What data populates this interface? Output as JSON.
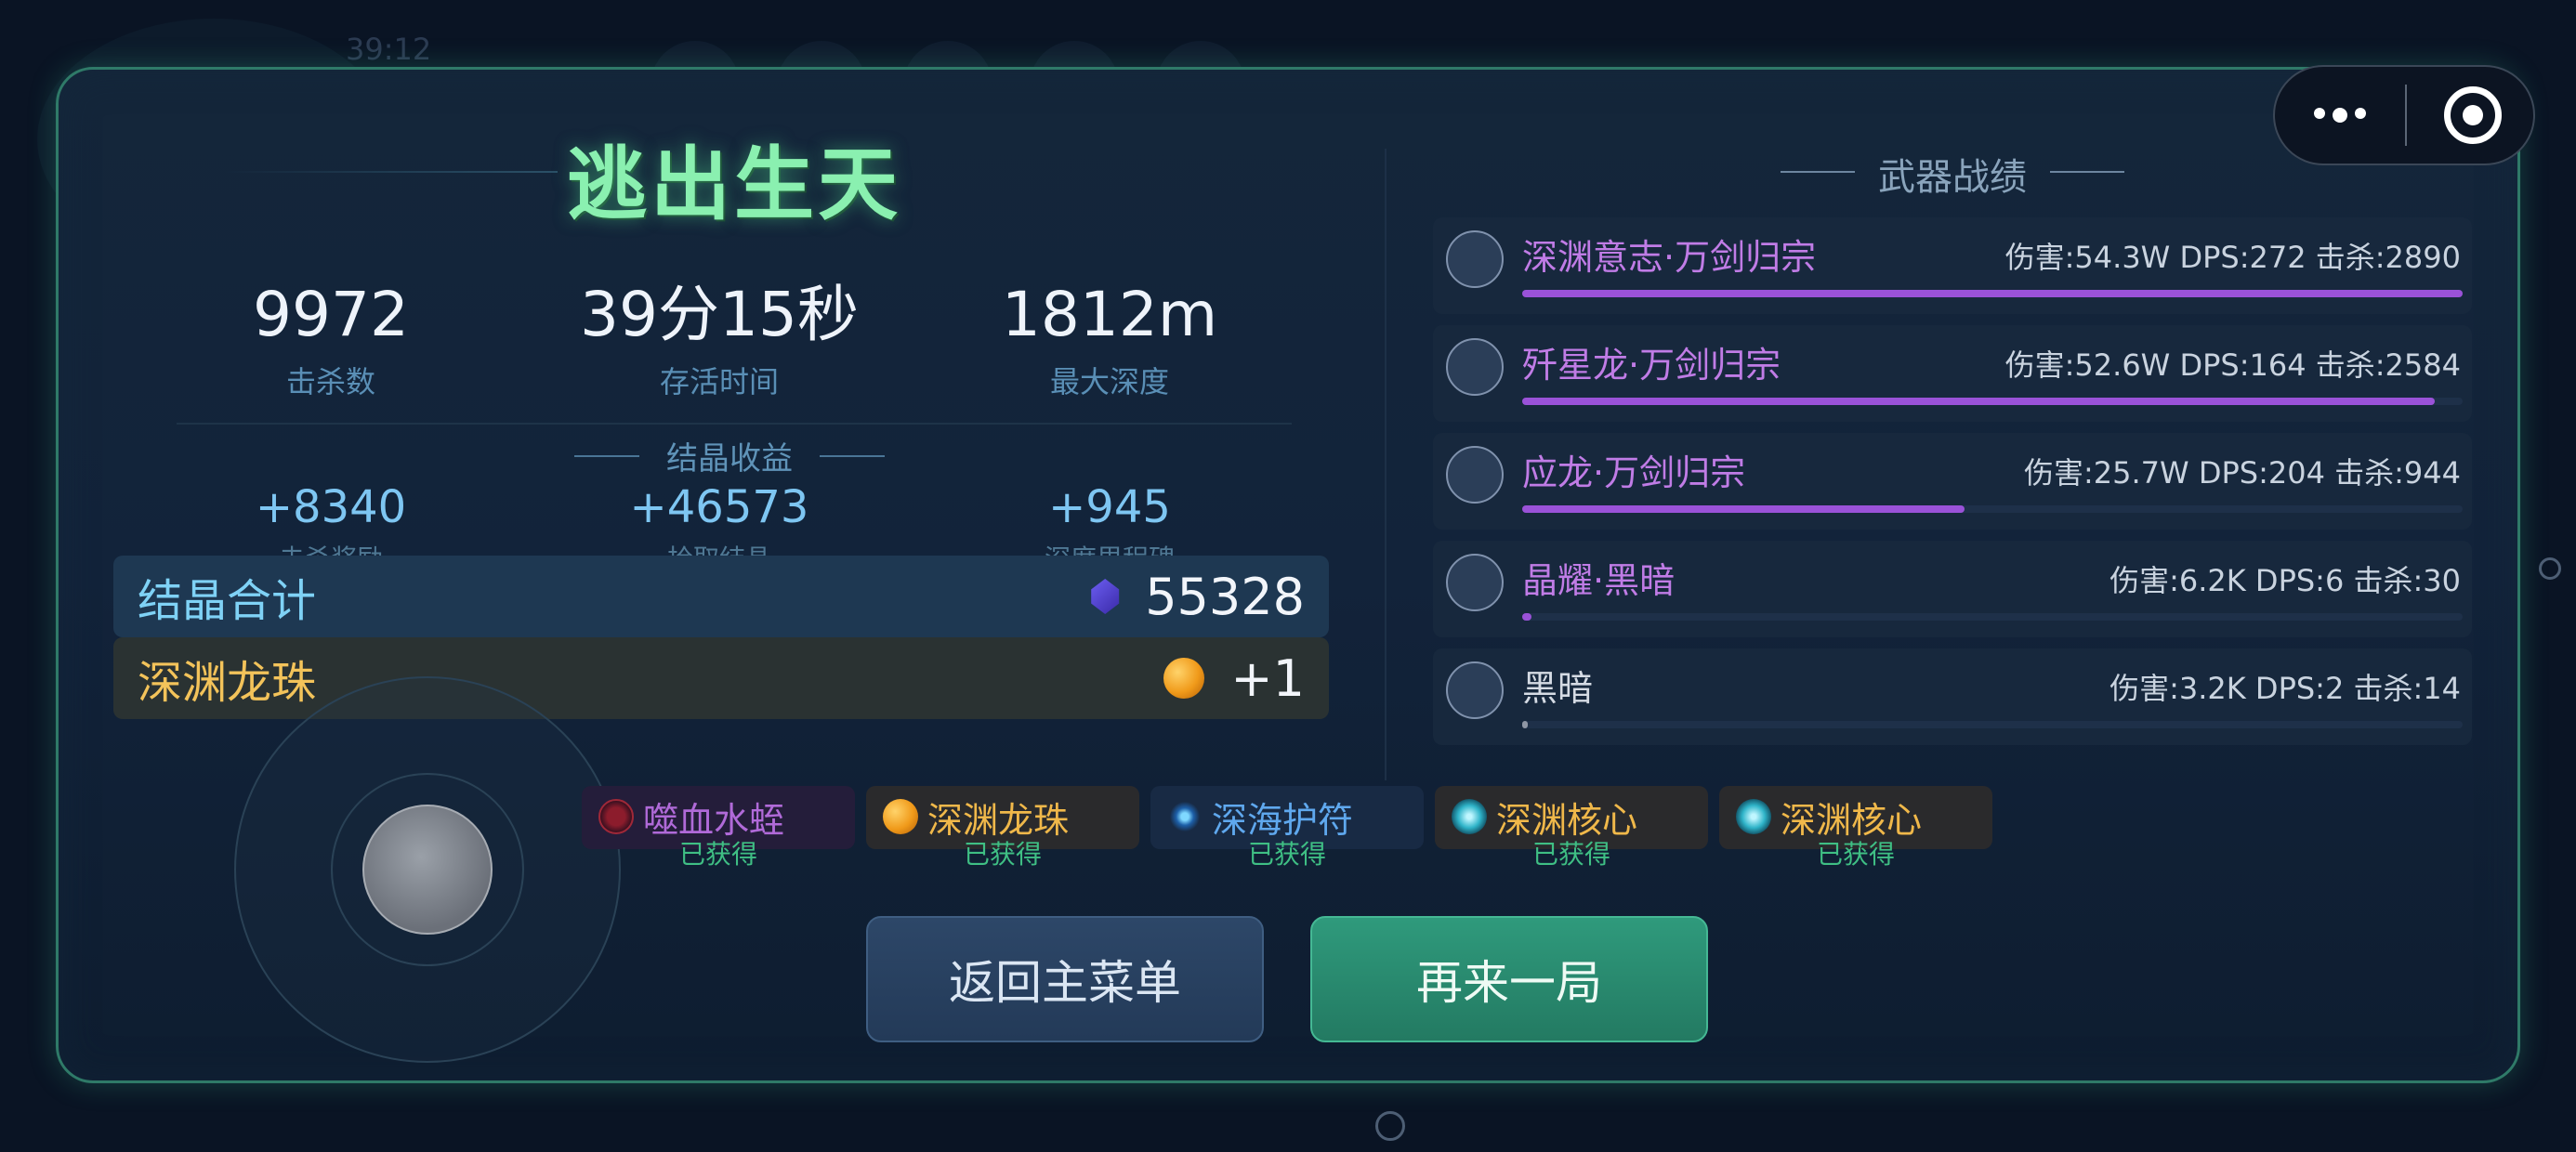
{
  "background": {
    "timer": "39:12"
  },
  "title": "逃出生天",
  "stats": [
    {
      "value": "9972",
      "label": "击杀数"
    },
    {
      "value": "39分15秒",
      "label": "存活时间"
    },
    {
      "value": "1812m",
      "label": "最大深度"
    }
  ],
  "crystal_income": {
    "title": "结晶收益",
    "items": [
      {
        "value": "+8340",
        "label": "击杀奖励"
      },
      {
        "value": "+46573",
        "label": "拾取结晶"
      },
      {
        "value": "+945",
        "label": "深度里程碑"
      }
    ]
  },
  "crystal_total": {
    "label": "结晶合计",
    "icon": "crystal-gem-icon",
    "value": "55328"
  },
  "dragon_pearl": {
    "label": "深渊龙珠",
    "icon": "dragon-pearl-icon",
    "value": "+1"
  },
  "items_obtained": [
    {
      "name": "噬血水蛭",
      "status": "已获得",
      "name_color": "#b06ad8",
      "bg": "#241d3a",
      "icon": "leech-icon"
    },
    {
      "name": "深渊龙珠",
      "status": "已获得",
      "name_color": "#f0b84a",
      "bg": "#2a2a2c",
      "icon": "dragon-pearl-icon"
    },
    {
      "name": "深海护符",
      "status": "已获得",
      "name_color": "#5fa8ee",
      "bg": "#182a44",
      "icon": "amulet-icon"
    },
    {
      "name": "深渊核心",
      "status": "已获得",
      "name_color": "#f0b84a",
      "bg": "#2a2a2c",
      "icon": "abyss-core-icon"
    },
    {
      "name": "深渊核心",
      "status": "已获得",
      "name_color": "#f0b84a",
      "bg": "#2a2a2c",
      "icon": "abyss-core-icon"
    }
  ],
  "buttons": {
    "menu": "返回主菜单",
    "again": "再来一局"
  },
  "weapons": {
    "title": "武器战绩",
    "list": [
      {
        "name": "深渊意志·万剑归宗",
        "stats": "伤害:54.3W DPS:272 击杀:2890",
        "progress": 1.0,
        "name_color": "#c07ce6"
      },
      {
        "name": "歼星龙·万剑归宗",
        "stats": "伤害:52.6W DPS:164 击杀:2584",
        "progress": 0.97,
        "name_color": "#c07ce6"
      },
      {
        "name": "应龙·万剑归宗",
        "stats": "伤害:25.7W DPS:204 击杀:944",
        "progress": 0.47,
        "name_color": "#c07ce6"
      },
      {
        "name": "晶耀·黑暗",
        "stats": "伤害:6.2K DPS:6 击杀:30",
        "progress": 0.01,
        "name_color": "#c07ce6"
      },
      {
        "name": "黑暗",
        "stats": "伤害:3.2K DPS:2 击杀:14",
        "progress": 0.005,
        "name_color": "#d5dbe4"
      }
    ]
  },
  "colors": {
    "accent_green": "#8af0b0",
    "panel_border": "#2f7a68",
    "weapon_bar": "#9a52d8"
  }
}
